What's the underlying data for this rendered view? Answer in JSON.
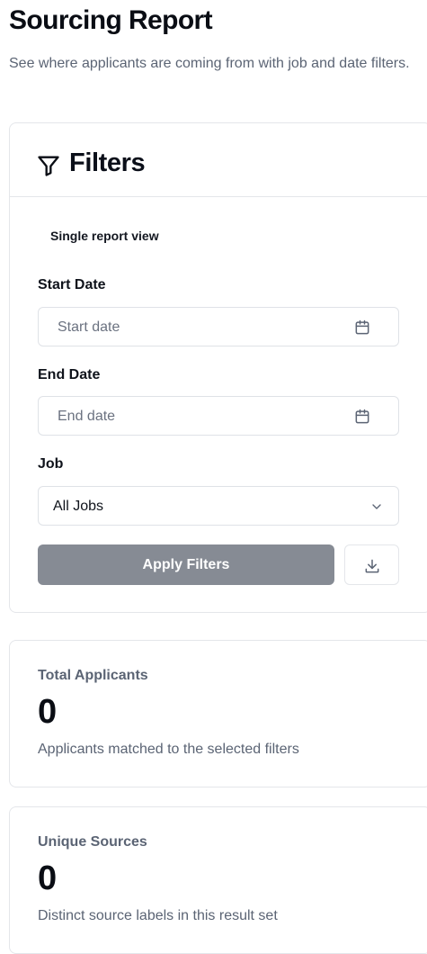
{
  "page": {
    "title": "Sourcing Report",
    "subtitle": "See where applicants are coming from with job and date filters."
  },
  "filters": {
    "title": "Filters",
    "view_label": "Single report view",
    "start_date": {
      "label": "Start Date",
      "placeholder": "Start date"
    },
    "end_date": {
      "label": "End Date",
      "placeholder": "End date"
    },
    "job": {
      "label": "Job",
      "selected": "All Jobs"
    },
    "apply_label": "Apply Filters"
  },
  "stats": [
    {
      "label": "Total Applicants",
      "value": "0",
      "description": "Applicants matched to the selected filters"
    },
    {
      "label": "Unique Sources",
      "value": "0",
      "description": "Distinct source labels in this result set"
    }
  ],
  "icons": {
    "filter": "filter-icon",
    "calendar": "calendar-icon",
    "chevron": "chevron-down-icon",
    "download": "download-icon"
  },
  "colors": {
    "apply_button": "#868b94",
    "muted_text": "#5b6474",
    "border": "#e4e6ea"
  }
}
